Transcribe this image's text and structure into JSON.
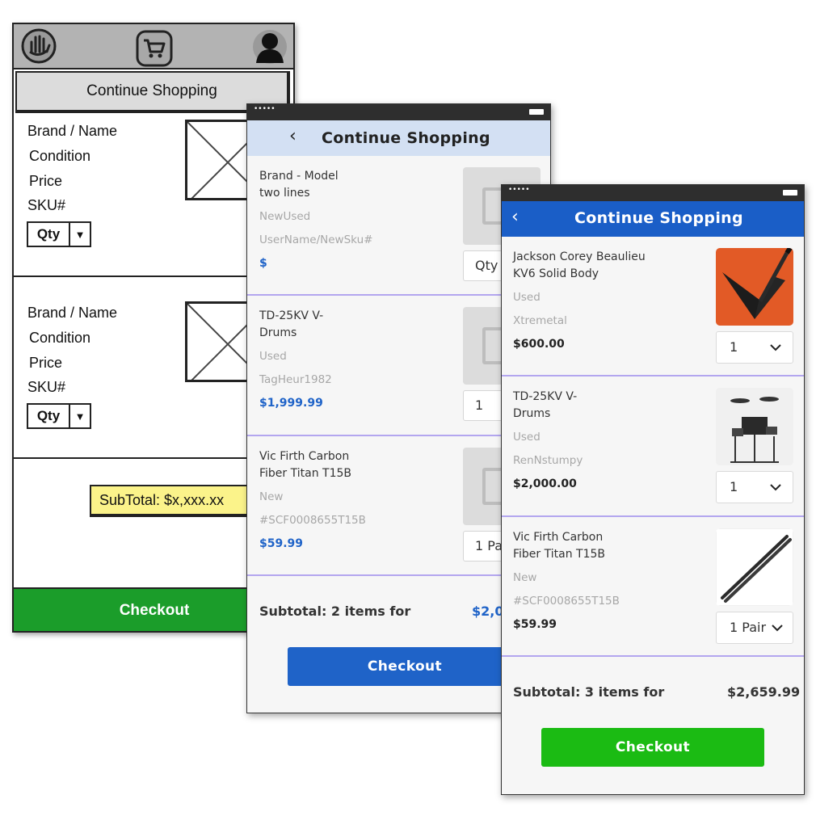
{
  "wireframe": {
    "continue_label": "Continue Shopping",
    "items": [
      {
        "brand": "Brand / Name",
        "condition": "Condition",
        "price": "Price",
        "sku": "SKU#",
        "qty": "Qty"
      },
      {
        "brand": "Brand / Name",
        "condition": "Condition",
        "price": "Price",
        "sku": "SKU#",
        "qty": "Qty"
      }
    ],
    "subtotal": "SubTotal: $x,xxx.xx",
    "checkout": "Checkout"
  },
  "midfi": {
    "status_dots": "•••••",
    "title": "Continue Shopping",
    "items": [
      {
        "line1": "Brand - Model",
        "line2": "two lines",
        "condition": "NewUsed",
        "seller": "UserName/NewSku#",
        "price": "$",
        "qty": "Qty"
      },
      {
        "line1": "TD-25KV V-",
        "line2": "Drums",
        "condition": "Used",
        "seller": "TagHeur1982",
        "price": "$1,999.99",
        "qty": "1"
      },
      {
        "line1": "Vic Firth Carbon",
        "line2": "Fiber Titan T15B",
        "condition": "New",
        "seller": "#SCF0008655T15B",
        "price": "$59.99",
        "qty": "1 Pai"
      }
    ],
    "subtotal_label": "Subtotal: 2 items for",
    "subtotal_value": "$2,0",
    "checkout": "Checkout",
    "price_color": "#1f63c8"
  },
  "hifi": {
    "status_dots": "•••••",
    "title": "Continue Shopping",
    "items": [
      {
        "line1": "Jackson Corey Beaulieu",
        "line2": "KV6 Solid Body",
        "condition": "Used",
        "seller": "Xtremetal",
        "price": "$600.00",
        "qty": "1"
      },
      {
        "line1": "TD-25KV V-",
        "line2": "Drums",
        "condition": "Used",
        "seller": "RenNstumpy",
        "price": "$2,000.00",
        "qty": "1"
      },
      {
        "line1": "Vic Firth Carbon",
        "line2": "Fiber Titan T15B",
        "condition": "New",
        "seller": "#SCF0008655T15B",
        "price": "$59.99",
        "qty": "1 Pair"
      }
    ],
    "subtotal_label": "Subtotal: 3 items for",
    "subtotal_value": "$2,659.99",
    "checkout": "Checkout",
    "header_color": "#1a5ec7",
    "checkout_color": "#1bbb13"
  }
}
